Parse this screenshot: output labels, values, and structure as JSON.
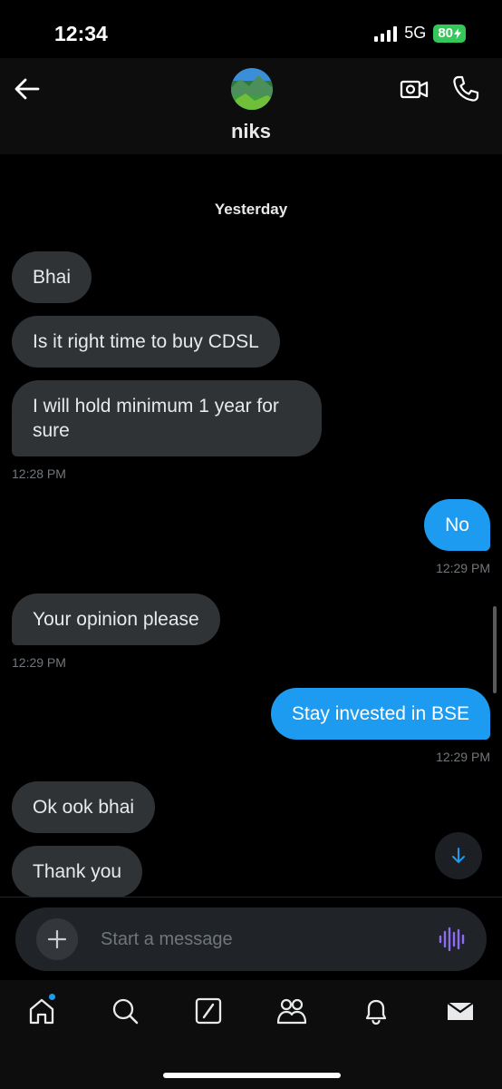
{
  "status_bar": {
    "time": "12:34",
    "network": "5G",
    "battery": "80"
  },
  "header": {
    "contact_name": "niks",
    "back_icon": "arrow-left-icon",
    "video_icon": "video-camera-icon",
    "phone_icon": "phone-icon"
  },
  "chat": {
    "date_separator": "Yesterday",
    "messages": [
      {
        "direction": "incoming",
        "text": "Bhai"
      },
      {
        "direction": "incoming",
        "text": "Is it right time to buy CDSL"
      },
      {
        "direction": "incoming",
        "text": "I will hold minimum 1 year for sure",
        "time": "12:28 PM"
      },
      {
        "direction": "outgoing",
        "text": "No",
        "time": "12:29 PM"
      },
      {
        "direction": "incoming",
        "text": "Your opinion please",
        "time": "12:29 PM"
      },
      {
        "direction": "outgoing",
        "text": "Stay invested in BSE",
        "time": "12:29 PM"
      },
      {
        "direction": "incoming",
        "text": "Ok ook bhai"
      },
      {
        "direction": "incoming",
        "text": "Thank you"
      }
    ]
  },
  "composer": {
    "placeholder": "Start a message",
    "value": ""
  },
  "tabbar": {
    "items": [
      "home",
      "search",
      "grok",
      "communities",
      "notifications",
      "messages"
    ]
  },
  "colors": {
    "accent": "#1d9bf0",
    "incoming_bubble": "#2f3336",
    "background": "#000000",
    "voice_icon": "#8c6cf2",
    "battery": "#34c759"
  }
}
